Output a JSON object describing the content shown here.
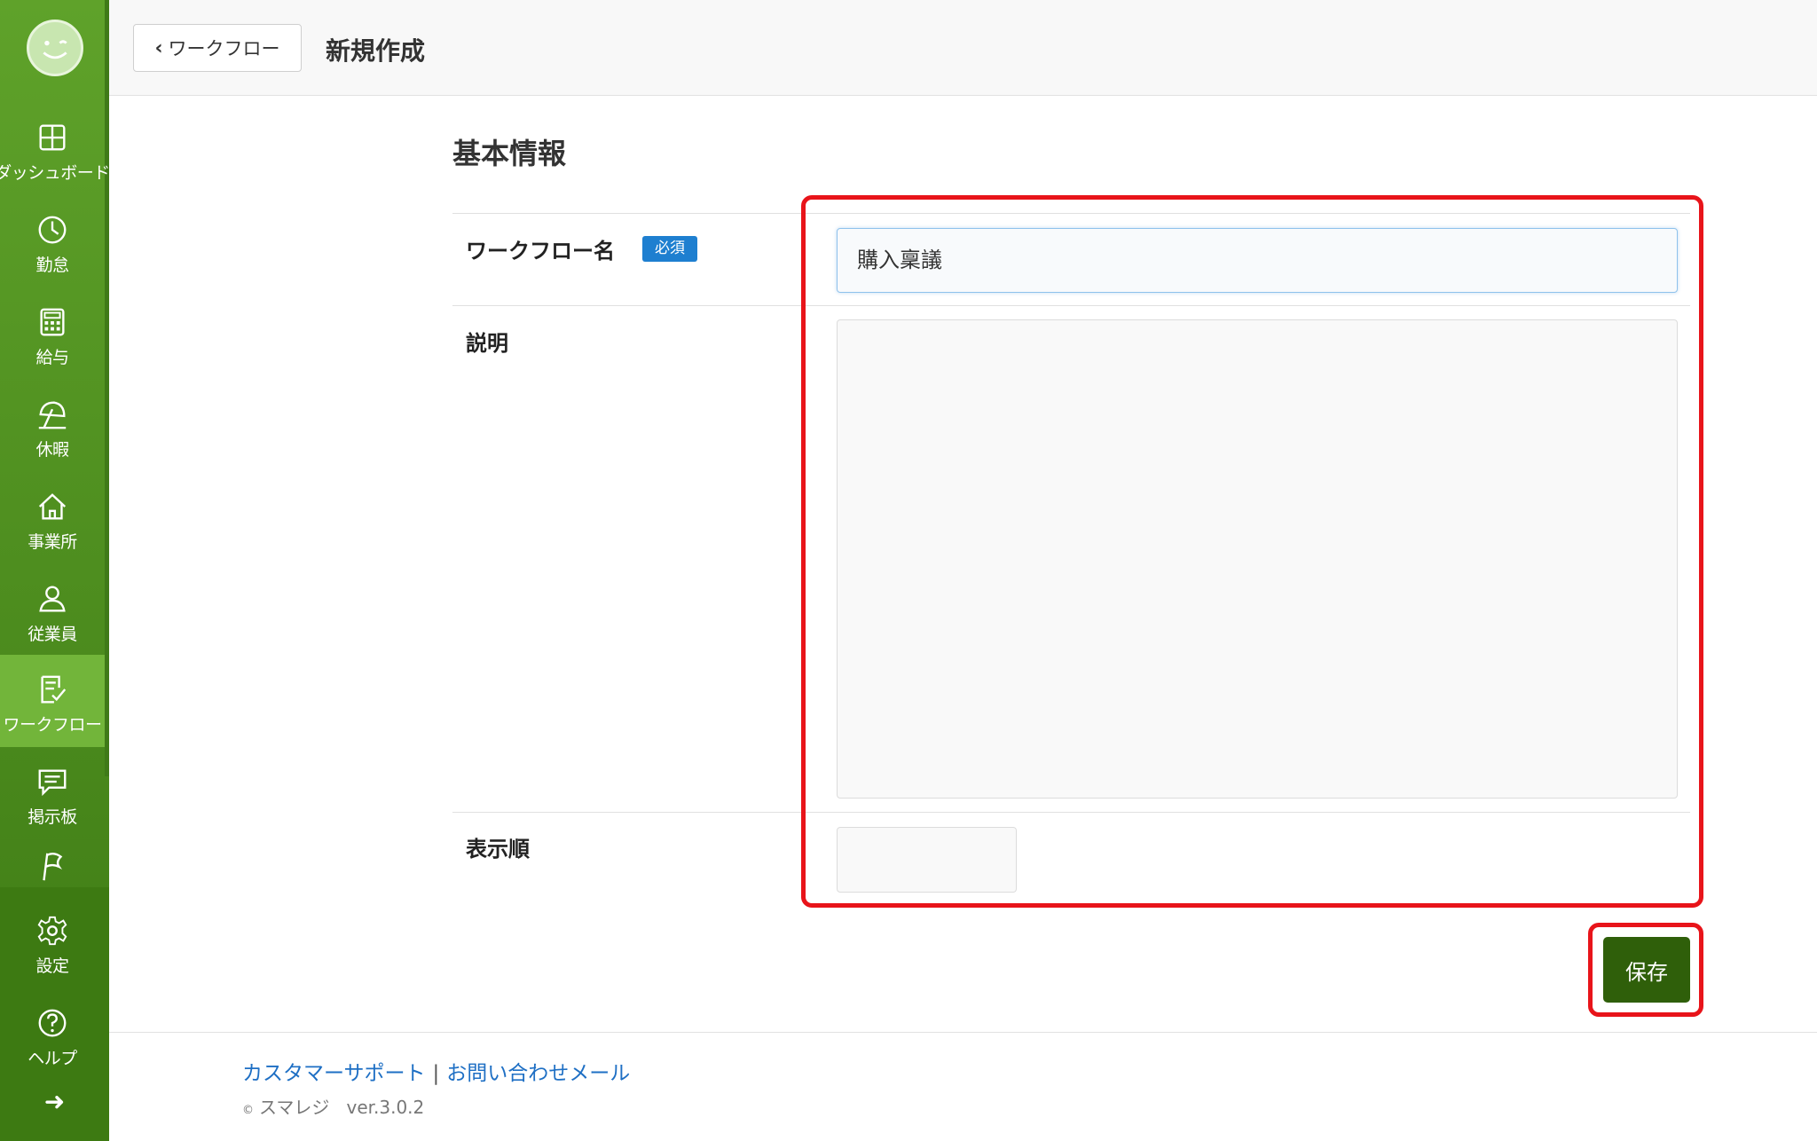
{
  "header": {
    "back_label": "ワークフロー",
    "title": "新規作成"
  },
  "sidebar": {
    "items": [
      {
        "label": "ダッシュボード",
        "icon": "dashboard-icon"
      },
      {
        "label": "勤怠",
        "icon": "clock-icon"
      },
      {
        "label": "給与",
        "icon": "calculator-icon"
      },
      {
        "label": "休暇",
        "icon": "umbrella-icon"
      },
      {
        "label": "事業所",
        "icon": "home-icon"
      },
      {
        "label": "従業員",
        "icon": "person-icon"
      },
      {
        "label": "ワークフロー",
        "icon": "checklist-icon",
        "active": true
      },
      {
        "label": "掲示板",
        "icon": "message-icon"
      },
      {
        "label": "",
        "icon": "flag-icon"
      },
      {
        "label": "設定",
        "icon": "gear-icon"
      },
      {
        "label": "ヘルプ",
        "icon": "help-icon"
      }
    ]
  },
  "form": {
    "section_title": "基本情報",
    "name_label": "ワークフロー名",
    "required_badge": "必須",
    "name_value": "購入稟議",
    "description_label": "説明",
    "description_value": "",
    "order_label": "表示順",
    "order_value": "",
    "save_label": "保存"
  },
  "footer": {
    "support_link": "カスタマーサポート",
    "separator": "|",
    "mail_link": "お問い合わせメール",
    "copyright": "スマレジ",
    "version": "ver.3.0.2"
  },
  "colors": {
    "sidebar": "#4f8f1e",
    "active": "#72b53a",
    "save_button": "#2f5f0a",
    "highlight": "#e8141a",
    "link": "#1e6fc4",
    "badge": "#1e7fd0"
  }
}
